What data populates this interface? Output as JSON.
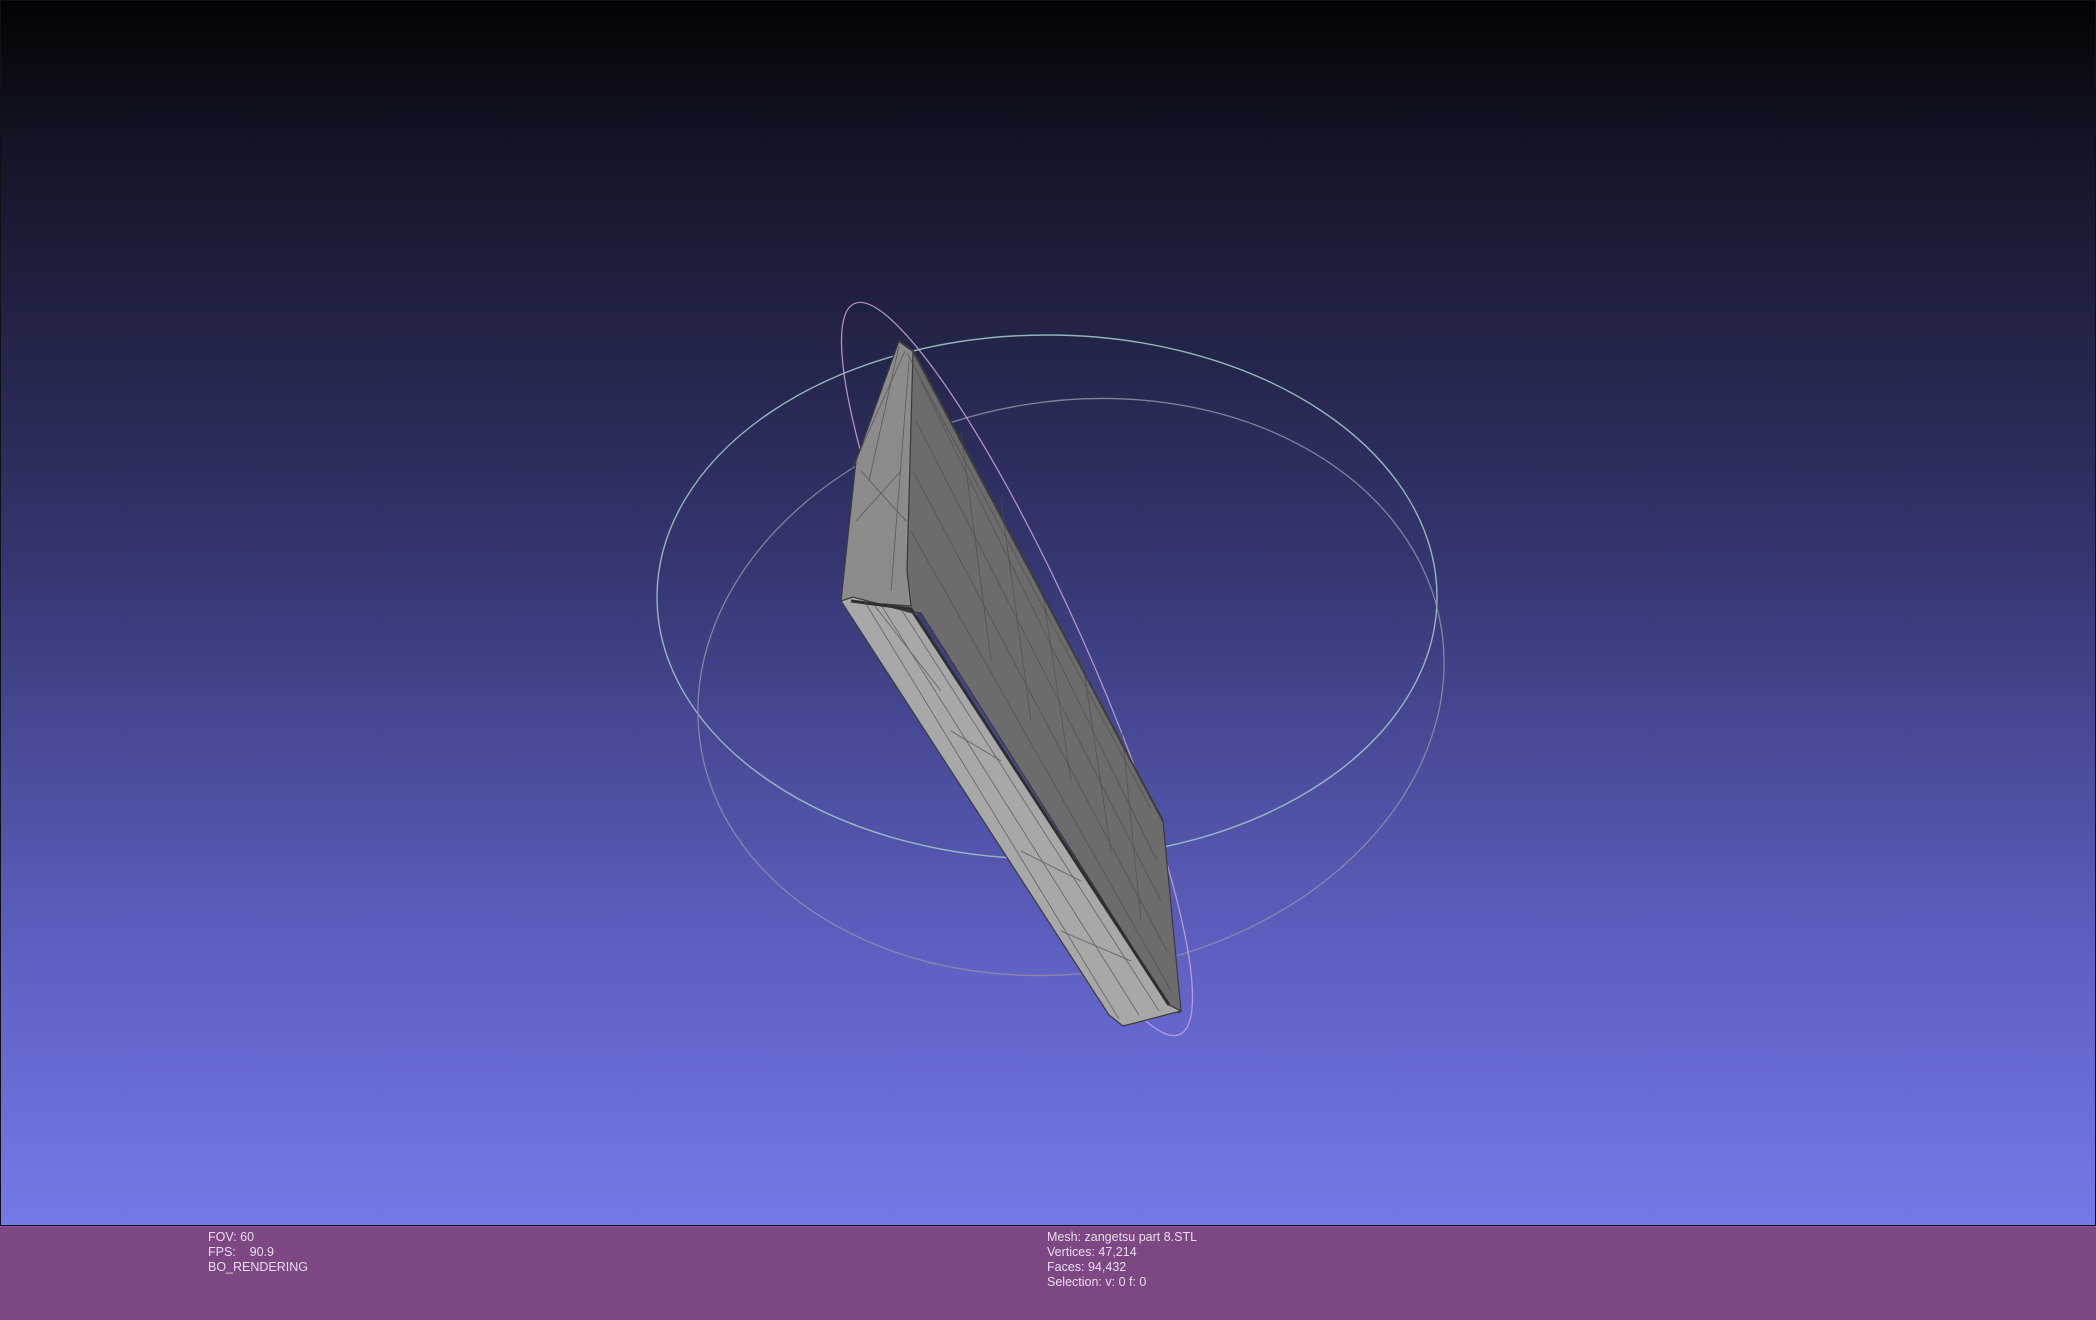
{
  "viewport": {
    "background_top": "#030305",
    "background_bottom": "#7578ea"
  },
  "info_bar": {
    "background": "#7d4783",
    "left": {
      "fov": "FOV: 60",
      "fps": "FPS:    90.9",
      "mode": "BO_RENDERING"
    },
    "right": {
      "mesh": "Mesh: zangetsu part 8.STL",
      "vertices": "Vertices: 47,214",
      "faces": "Faces: 94,432",
      "selection": "Selection: v: 0 f: 0"
    }
  },
  "trackball": {
    "ring_colors": [
      "#9fc3c8",
      "#b493c8",
      "#8f8fa8"
    ]
  },
  "mesh_colors": {
    "top_face": "#6c6c6c",
    "side_face": "#a9a9a9",
    "end_face": "#8a8a8a",
    "wire": "#3a3a3a"
  }
}
